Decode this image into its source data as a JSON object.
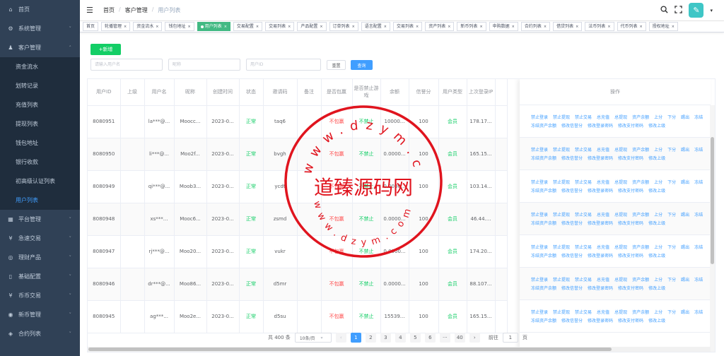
{
  "sidebar": {
    "items": [
      {
        "icon": "home-icon",
        "glyph": "⌂",
        "label": "首页",
        "chevron": false
      },
      {
        "icon": "gear-icon",
        "glyph": "⚙",
        "label": "系统管理",
        "chevron": true
      },
      {
        "icon": "users-icon",
        "glyph": "♟",
        "label": "客户管理",
        "chevron": true,
        "open": true
      }
    ],
    "subitems": [
      "资金流水",
      "划转记录",
      "充值列表",
      "提现列表",
      "钱包地址",
      "银行收款",
      "初高级认证列表",
      "用户列表"
    ],
    "active_sub": "用户列表",
    "items_after": [
      {
        "icon": "grid-icon",
        "glyph": "▦",
        "label": "平台管理"
      },
      {
        "icon": "yen-icon",
        "glyph": "¥",
        "label": "急速交易"
      },
      {
        "icon": "finance-icon",
        "glyph": "◎",
        "label": "理财产品"
      },
      {
        "icon": "book-icon",
        "glyph": "▯",
        "label": "基础配置"
      },
      {
        "icon": "yen-icon",
        "glyph": "¥",
        "label": "币币交易"
      },
      {
        "icon": "coin-icon",
        "glyph": "◉",
        "label": "新币管理"
      },
      {
        "icon": "contract-icon",
        "glyph": "◈",
        "label": "合约列表"
      }
    ]
  },
  "header": {
    "breadcrumb": [
      "首页",
      "客户管理",
      "用户列表"
    ]
  },
  "tags": [
    {
      "label": "首页",
      "close": false
    },
    {
      "label": "轮播管理",
      "close": true
    },
    {
      "label": "资金流水",
      "close": true
    },
    {
      "label": "钱包地址",
      "close": true
    },
    {
      "label": "用户列表",
      "close": true,
      "active": true
    },
    {
      "label": "交易配置",
      "close": true
    },
    {
      "label": "交易列表",
      "close": true
    },
    {
      "label": "产品配置",
      "close": true
    },
    {
      "label": "订单列表",
      "close": true
    },
    {
      "label": "语言配置",
      "close": true
    },
    {
      "label": "交易列表",
      "close": true
    },
    {
      "label": "资产列表",
      "close": true
    },
    {
      "label": "新币列表",
      "close": true
    },
    {
      "label": "申购数据",
      "close": true
    },
    {
      "label": "合约列表",
      "close": true
    },
    {
      "label": "借贷列表",
      "close": true
    },
    {
      "label": "法币列表",
      "close": true
    },
    {
      "label": "代币列表",
      "close": true
    },
    {
      "label": "授权地址",
      "close": true
    }
  ],
  "toolbar": {
    "add_label": "+新增",
    "username_placeholder": "请输入用户名",
    "nickname_placeholder": "昵称",
    "userid_placeholder": "用户ID",
    "reset_label": "重置",
    "query_label": "查询"
  },
  "table": {
    "headers": [
      "用户ID",
      "上级",
      "用户名",
      "昵称",
      "创建时间",
      "状态",
      "邀请码",
      "备注",
      "是否包赢",
      "是否禁止游戏",
      "余额",
      "信誉分",
      "用户类型",
      "上次登录IP"
    ],
    "ops_header": "操作",
    "rows": [
      [
        "8080951",
        "",
        "la***@...",
        "Moocc...",
        "2023-0...",
        "正常",
        "taq6",
        "",
        "不包赢",
        "不禁止",
        "10000...",
        "100",
        "会员",
        "178.17..."
      ],
      [
        "8080950",
        "",
        "li***@...",
        "Moo2f...",
        "2023-0...",
        "正常",
        "bvgh",
        "",
        "不包赢",
        "不禁止",
        "0.0000...",
        "100",
        "会员",
        "165.15..."
      ],
      [
        "8080949",
        "",
        "qi***@...",
        "Moob3...",
        "2023-0...",
        "正常",
        "ycdt",
        "",
        "不包赢",
        "不禁止",
        "0.0000...",
        "100",
        "会员",
        "103.14..."
      ],
      [
        "8080948",
        "",
        "xs***...",
        "Mooc6...",
        "2023-0...",
        "正常",
        "zsmd",
        "",
        "不包赢",
        "不禁止",
        "0.0000...",
        "100",
        "会员",
        "46.44...."
      ],
      [
        "8080947",
        "",
        "rj***@...",
        "Moo20...",
        "2023-0...",
        "正常",
        "vukr",
        "",
        "不包赢",
        "不禁止",
        "0.0000...",
        "100",
        "会员",
        "174.20..."
      ],
      [
        "8080946",
        "",
        "dr***@...",
        "Moo86...",
        "2023-0...",
        "正常",
        "d5mr",
        "",
        "不包赢",
        "不禁止",
        "0.0000...",
        "100",
        "会员",
        "88.107..."
      ],
      [
        "8080945",
        "",
        "ag***...",
        "Moo2e...",
        "2023-0...",
        "正常",
        "d5su",
        "",
        "不包赢",
        "不禁止",
        "15539...",
        "100",
        "会员",
        "165.15..."
      ]
    ],
    "ops": [
      "禁止登录",
      "禁止提现",
      "禁止交易",
      "总充值",
      "总提现",
      "资产余额",
      "上分",
      "下分",
      "踢出",
      "冻结",
      "冻结资产余额",
      "修改信誉分",
      "修改登录密码",
      "修改支付密码",
      "修改上级"
    ]
  },
  "pagination": {
    "total": "共 400 条",
    "page_size": "10条/页",
    "pages": [
      "1",
      "2",
      "3",
      "4",
      "5",
      "6",
      "···",
      "40"
    ],
    "current": "1",
    "goto_label": "前往",
    "goto_value": "1",
    "page_suffix": "页"
  },
  "watermark": {
    "brand": "道臻源码网",
    "url_top": "www.dzym.com",
    "url_bottom": "www.dzym.com"
  },
  "colors": {
    "sidebar_bg": "#304156",
    "primary": "#409eff",
    "success": "#13ce66",
    "danger": "#ff4949",
    "tag_active": "#42b983",
    "watermark": "#e0141e"
  }
}
